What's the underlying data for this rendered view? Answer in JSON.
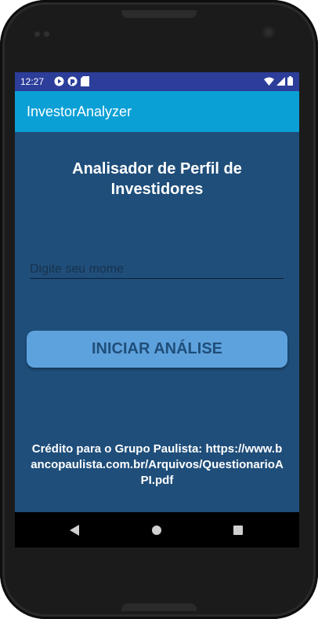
{
  "status_bar": {
    "time": "12:27",
    "left_icons": [
      "play-protect-icon",
      "sync-icon",
      "sd-card-icon"
    ],
    "right_icons": [
      "wifi-icon",
      "signal-icon",
      "battery-icon"
    ]
  },
  "app_bar": {
    "title": "InvestorAnalyzer"
  },
  "main": {
    "heading": "Analisador de Perfil de Investidores",
    "name_input": {
      "placeholder": "Digite seu mome",
      "value": ""
    },
    "start_button_label": "INICIAR ANÁLISE",
    "credit": "Crédito para o Grupo Paulista: https://www.bancopaulista.com.br/Arquivos/QuestionarioAPI.pdf"
  },
  "nav_bar": {
    "buttons": [
      "back-icon",
      "home-icon",
      "recents-icon"
    ]
  },
  "colors": {
    "status_bar": "#2c3e9a",
    "app_bar": "#0aa0d6",
    "background": "#1f4e7a",
    "button": "#5ea2dd"
  }
}
